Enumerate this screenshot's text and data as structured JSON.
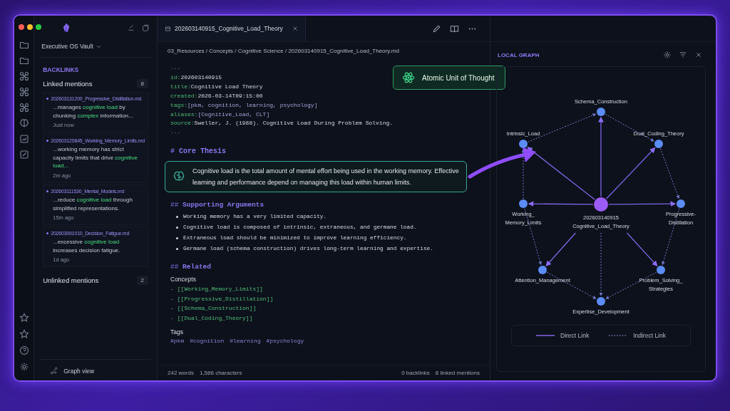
{
  "vault": {
    "name": "Executive OS Vault"
  },
  "backlinks": {
    "title": "BACKLINKS",
    "linked": {
      "label": "Linked mentions",
      "count": "8"
    },
    "items": [
      {
        "file": "202603131200_Progressive_Distillation.md",
        "excerpt": "...manages **cognitive load** by chunking **complex** information...",
        "time": "Just now"
      },
      {
        "file": "202603120845_Working_Memory_Limits.md",
        "excerpt": "...working memory has strict capacity limits that drive **cognitive load...**",
        "time": "2m ago"
      },
      {
        "file": "202603111530_Mental_Models.md",
        "excerpt": "...reduce **cognitive load** through simplified representations.",
        "time": "15m ago"
      },
      {
        "file": "202603091010_Decision_Fatigue.md",
        "excerpt": "...excessive **cognitive load** increases decision fatigue.",
        "time": "1d ago"
      }
    ],
    "unlinked": {
      "label": "Unlinked mentions",
      "count": "2"
    }
  },
  "graph_view": {
    "label": "Graph view"
  },
  "tab": {
    "title": "202603140915_Cognitive_Load_Theory"
  },
  "breadcrumb": "03_Resources / Concepts / Cognitive Science / 202603140915_Cognitive_Load_Theory.md",
  "badge": {
    "label": "Atomic Unit of Thought"
  },
  "frontmatter": {
    "open": "---",
    "close": "---",
    "fields": [
      {
        "key": "id:",
        "value": "202603140915",
        "kind": "text"
      },
      {
        "key": "title:",
        "value": "Cognitive Load Theory",
        "kind": "text"
      },
      {
        "key": "created:",
        "value": "2026-03-14T09:15:00",
        "kind": "text"
      },
      {
        "key": "tags:",
        "value": "[pkm, cognition, learning, psychology]",
        "kind": "list"
      },
      {
        "key": "aliases:",
        "value": "[Cognitive_Load, CLT]",
        "kind": "list"
      },
      {
        "key": "source:",
        "value": "Sweller, J. (1988). Cognitive Load During Problem Solving.",
        "kind": "text"
      }
    ]
  },
  "core": {
    "marker": "#",
    "heading": "Core Thesis",
    "callout": "Cognitive load is the total amount of mental effort being used in the working memory. Effective learning and performance depend on managing this load within human limits."
  },
  "supporting": {
    "marker": "##",
    "heading": "Supporting Arguments",
    "items": [
      "Working memory has a very limited capacity.",
      "Cognitive load is composed of intrinsic, extraneous, and germane load.",
      "Extraneous load should be minimized to improve learning efficiency.",
      "Germane load (schema construction) drives long-term learning and expertise."
    ]
  },
  "related": {
    "marker": "##",
    "heading": "Related",
    "concepts_label": "Concepts",
    "dash": "-",
    "concepts": [
      "[[Working_Memory_Limits]]",
      "[[Progressive_Distillation]]",
      "[[Schema_Construction]]",
      "[[Dual_Coding_Theory]]"
    ],
    "tags_label": "Tags",
    "tags": [
      "#pkm",
      "#cognition",
      "#learning",
      "#psychology"
    ]
  },
  "status_bar": {
    "words": "242 words",
    "characters": "1,586 characters",
    "backlinks": "0 backlinks",
    "mentions": "8 linked mentions"
  },
  "graph": {
    "title": "LOCAL GRAPH",
    "nodes": [
      {
        "lines": [
          "Schema_Construction"
        ],
        "kind": "note"
      },
      {
        "lines": [
          "Intrinsic_Load"
        ],
        "kind": "note"
      },
      {
        "lines": [
          "Dual_Coding_Theory"
        ],
        "kind": "note"
      },
      {
        "lines": [
          "Working_",
          "Memory_Limits"
        ],
        "kind": "note"
      },
      {
        "lines": [
          "202603140915",
          "Cognitive_Load_Theory"
        ],
        "kind": "center"
      },
      {
        "lines": [
          "Progressive-",
          "Distillation"
        ],
        "kind": "note"
      },
      {
        "lines": [
          "Attention_Management"
        ],
        "kind": "note"
      },
      {
        "lines": [
          "Problem_Solving_",
          "Strategies"
        ],
        "kind": "note"
      },
      {
        "lines": [
          "Expertise_Development"
        ],
        "kind": "note"
      }
    ],
    "edges": [
      {
        "kind": "direct"
      },
      {
        "kind": "direct"
      },
      {
        "kind": "direct"
      },
      {
        "kind": "direct"
      },
      {
        "kind": "direct"
      },
      {
        "kind": "direct"
      },
      {
        "kind": "direct"
      },
      {
        "kind": "indirect"
      },
      {
        "kind": "indirect"
      },
      {
        "kind": "indirect"
      },
      {
        "kind": "indirect"
      },
      {
        "kind": "indirect"
      },
      {
        "kind": "indirect"
      },
      {
        "kind": "indirect"
      },
      {
        "kind": "indirect"
      },
      {
        "kind": "indirect"
      }
    ],
    "legend": [
      {
        "kind": "direct",
        "label": "Direct Link"
      },
      {
        "kind": "indirect",
        "label": "Indirect Link"
      }
    ]
  }
}
